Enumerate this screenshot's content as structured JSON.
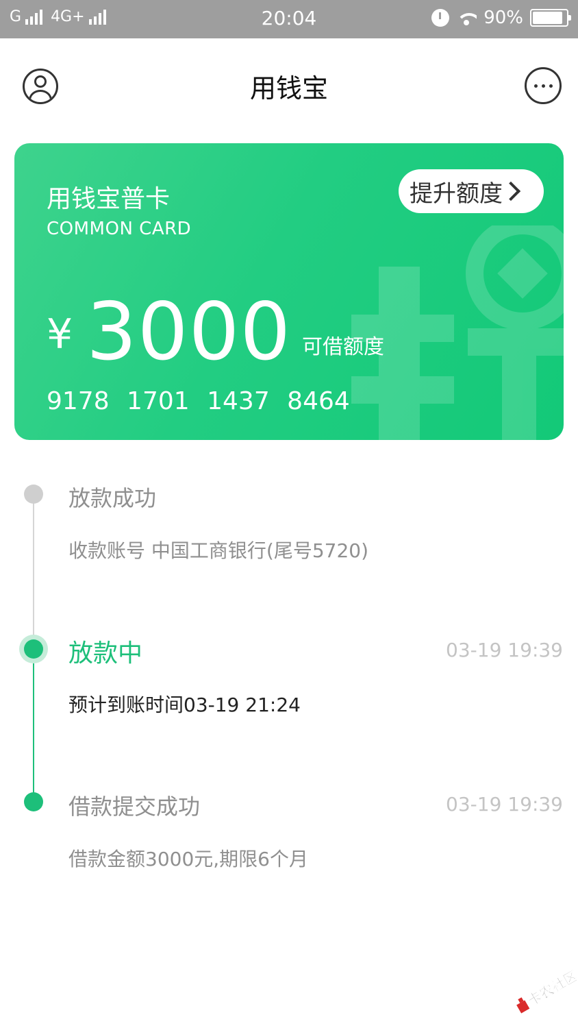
{
  "status_bar": {
    "carrier_left": "G",
    "network": "4G+",
    "time": "20:04",
    "battery": "90%",
    "battery_level": 0.9
  },
  "nav": {
    "title": "用钱宝",
    "profile_icon": "user-circle-icon",
    "more_icon": "more-dots-icon"
  },
  "card": {
    "title": "用钱宝普卡",
    "subtitle": "COMMON CARD",
    "raise_button": "提升额度",
    "currency": "¥",
    "amount": "3000",
    "amount_label": "可借额度",
    "number": "9178 1701 1437 8464",
    "color_start": "#3ed38d",
    "color_end": "#13c978"
  },
  "timeline": [
    {
      "title": "放款成功",
      "desc": "收款账号 中国工商银行(尾号5720)",
      "time": "",
      "state": "pending"
    },
    {
      "title": "放款中",
      "desc": "预计到账时间03-19 21:24",
      "time": "03-19 19:39",
      "state": "current"
    },
    {
      "title": "借款提交成功",
      "desc": "借款金额3000元,期限6个月",
      "time": "03-19 19:39",
      "state": "done"
    }
  ],
  "colors": {
    "accent": "#1dbf7a",
    "muted": "#8f8f8f",
    "dot_pending": "#cfcfcf"
  },
  "watermark": {
    "text": "卡农社区"
  }
}
